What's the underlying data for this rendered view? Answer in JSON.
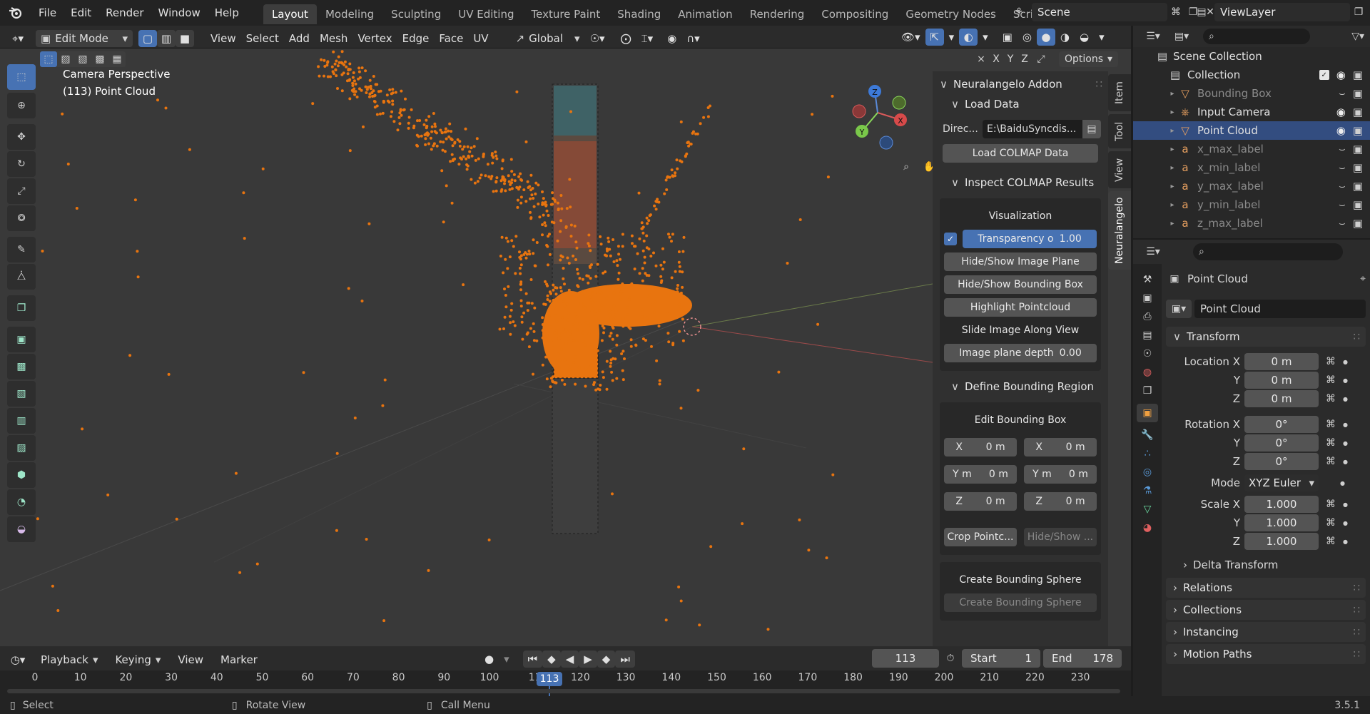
{
  "menu": [
    "File",
    "Edit",
    "Render",
    "Window",
    "Help"
  ],
  "workspaces": [
    {
      "label": "Layout",
      "active": true
    },
    {
      "label": "Modeling"
    },
    {
      "label": "Sculpting"
    },
    {
      "label": "UV Editing"
    },
    {
      "label": "Texture Paint"
    },
    {
      "label": "Shading"
    },
    {
      "label": "Animation"
    },
    {
      "label": "Rendering"
    },
    {
      "label": "Compositing"
    },
    {
      "label": "Geometry Nodes"
    },
    {
      "label": "Scripting"
    }
  ],
  "scene": "Scene",
  "view_layer": "ViewLayer",
  "viewport_header": {
    "mode": "Edit Mode",
    "menus": [
      "View",
      "Select",
      "Add",
      "Mesh",
      "Vertex",
      "Edge",
      "Face",
      "UV"
    ],
    "orientation": "Global",
    "axes": [
      "X",
      "Y",
      "Z"
    ],
    "options": "Options"
  },
  "viewport": {
    "camera_label": "Camera Perspective",
    "object_label": "(113) Point Cloud"
  },
  "npanel": {
    "tabs": [
      "Item",
      "Tool",
      "View",
      "Neuralangelo"
    ],
    "addon_title": "Neuralangelo Addon",
    "load_data": "Load Data",
    "directory_label": "Direc...",
    "directory_value": "E:\\BaiduSyncdis...",
    "load_colmap": "Load COLMAP Data",
    "inspect_title": "Inspect COLMAP Results",
    "visualization": "Visualization",
    "transparency_label": "Transparency o",
    "transparency_value": "1.00",
    "hide_image_plane": "Hide/Show Image Plane",
    "hide_bbox": "Hide/Show Bounding Box",
    "highlight": "Highlight Pointcloud",
    "slide_image": "Slide Image Along View",
    "depth_label": "Image plane depth",
    "depth_value": "0.00",
    "define_title": "Define Bounding Region",
    "edit_bbox": "Edit Bounding Box",
    "bbox_rows": [
      {
        "l": "X",
        "lv": "0 m",
        "r": "X",
        "rv": "0 m"
      },
      {
        "l": "Y m",
        "lv": "0 m",
        "r": "Y m",
        "rv": "0 m"
      },
      {
        "l": "Z",
        "lv": "0 m",
        "r": "Z",
        "rv": "0 m"
      }
    ],
    "crop": "Crop Pointc...",
    "hide_show": "Hide/Show ...",
    "sphere_title": "Create Bounding Sphere",
    "sphere_btn": "Create Bounding Sphere"
  },
  "outliner": {
    "root": "Scene Collection",
    "items": [
      {
        "label": "Collection",
        "dim": false
      },
      {
        "label": "Bounding Box",
        "dim": true
      },
      {
        "label": "Input Camera",
        "dim": false
      },
      {
        "label": "Point Cloud",
        "dim": false
      },
      {
        "label": "x_max_label",
        "dim": true
      },
      {
        "label": "x_min_label",
        "dim": true
      },
      {
        "label": "y_max_label",
        "dim": true
      },
      {
        "label": "y_min_label",
        "dim": true
      },
      {
        "label": "z_max_label",
        "dim": true
      }
    ]
  },
  "properties": {
    "object_name": "Point Cloud",
    "data_name": "Point Cloud",
    "transform": "Transform",
    "location": [
      {
        "label": "Location X",
        "value": "0 m"
      },
      {
        "label": "Y",
        "value": "0 m"
      },
      {
        "label": "Z",
        "value": "0 m"
      }
    ],
    "rotation": [
      {
        "label": "Rotation X",
        "value": "0°"
      },
      {
        "label": "Y",
        "value": "0°"
      },
      {
        "label": "Z",
        "value": "0°"
      }
    ],
    "mode_label": "Mode",
    "mode_value": "XYZ Euler",
    "scale": [
      {
        "label": "Scale X",
        "value": "1.000"
      },
      {
        "label": "Y",
        "value": "1.000"
      },
      {
        "label": "Z",
        "value": "1.000"
      }
    ],
    "delta": "Delta Transform",
    "panels": [
      "Relations",
      "Collections",
      "Instancing",
      "Motion Paths"
    ]
  },
  "timeline": {
    "menus": [
      "Playback",
      "Keying",
      "View",
      "Marker"
    ],
    "current_frame": "113",
    "start_label": "Start",
    "start": "1",
    "end_label": "End",
    "end": "178",
    "ticks": [
      "0",
      "10",
      "20",
      "30",
      "40",
      "50",
      "60",
      "70",
      "80",
      "90",
      "100",
      "11",
      "120",
      "130",
      "140",
      "150",
      "160",
      "170",
      "180",
      "190",
      "200",
      "210",
      "220",
      "230"
    ],
    "playhead": "113"
  },
  "status": {
    "select": "Select",
    "rotate": "Rotate View",
    "call_menu": "Call Menu",
    "version": "3.5.1"
  },
  "colors": {
    "accent": "#4772b3",
    "points": "#e8740f"
  }
}
